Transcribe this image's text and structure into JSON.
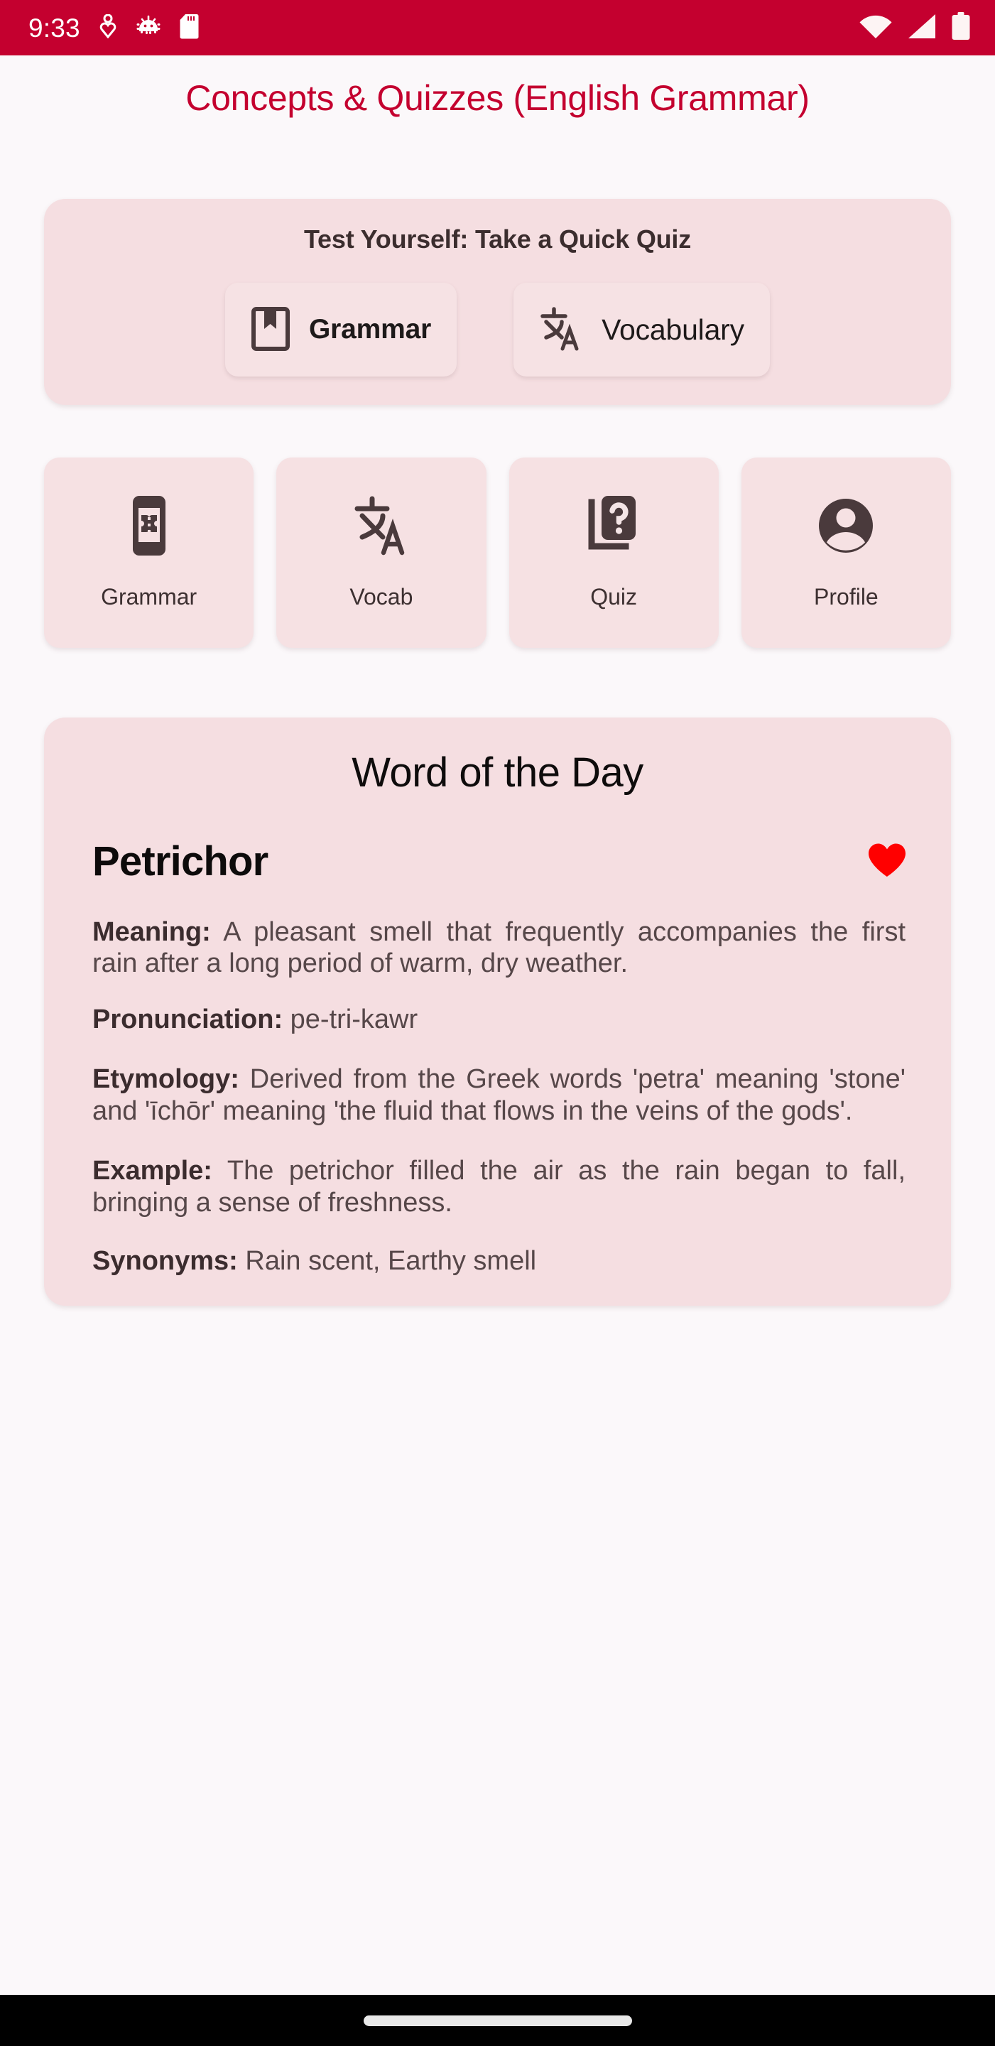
{
  "status_bar": {
    "clock": "9:33",
    "background": "#C4002F",
    "left_icons": [
      "location-heart-icon",
      "android-bug-icon",
      "sd-card-icon"
    ],
    "right_icons": [
      "wifi-icon",
      "cellular-signal-icon",
      "battery-icon"
    ]
  },
  "header": {
    "title": "Concepts & Quizzes (English Grammar)",
    "title_color": "#C4002F"
  },
  "quiz_card": {
    "title": "Test Yourself: Take a Quick Quiz",
    "buttons": [
      {
        "label": "Grammar",
        "icon": "book-bookmark-icon"
      },
      {
        "label": "Vocabulary",
        "icon": "translate-icon"
      }
    ]
  },
  "nav_tiles": [
    {
      "label": "Grammar",
      "icon": "article-book-icon"
    },
    {
      "label": "Vocab",
      "icon": "translate-icon"
    },
    {
      "label": "Quiz",
      "icon": "quiz-question-book-icon"
    },
    {
      "label": "Profile",
      "icon": "account-circle-icon"
    }
  ],
  "word_of_the_day": {
    "section_title": "Word of the Day",
    "word": "Petrichor",
    "favorite_icon": "heart-filled-icon",
    "favorite_color": "#FF0000",
    "favorite_active": true,
    "fields": {
      "meaning_label": "Meaning:",
      "meaning_value": " A pleasant smell that frequently accompanies the first rain after a long period of warm, dry weather.",
      "pronunciation_label": "Pronunciation:",
      "pronunciation_value": " pe-tri-kawr",
      "etymology_label": "Etymology:",
      "etymology_value": " Derived from the Greek words 'petra' meaning 'stone' and 'īchōr' meaning 'the fluid that flows in the veins of the gods'.",
      "example_label": "Example:",
      "example_value": " The petrichor filled the air as the rain began to fall, bringing a sense of freshness.",
      "synonyms_label": "Synonyms:",
      "synonyms_value": " Rain scent, Earthy smell"
    }
  },
  "theme": {
    "page_background": "#FBF8FA",
    "card_background": "#F5DEE1",
    "tile_background": "#F6E1E3",
    "accent": "#C4002F",
    "icon_color": "#4A3A3C"
  }
}
